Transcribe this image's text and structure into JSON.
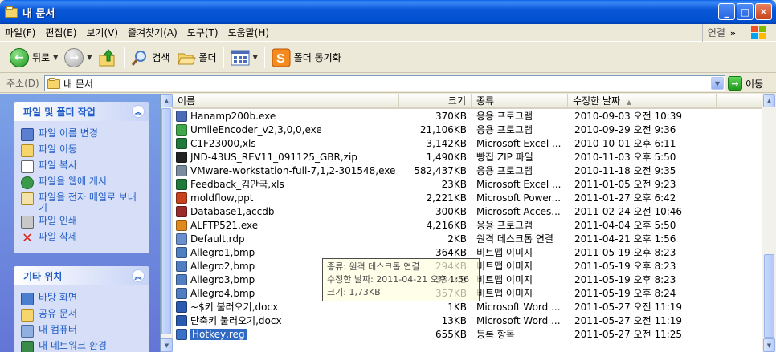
{
  "window": {
    "title": "내 문서"
  },
  "menu": {
    "items": [
      "파일(F)",
      "편집(E)",
      "보기(V)",
      "즐겨찾기(A)",
      "도구(T)",
      "도움말(H)"
    ],
    "links_label": "연결",
    "links_chevron": "»"
  },
  "toolbar": {
    "back_label": "뒤로",
    "search_label": "검색",
    "folders_label": "폴더",
    "sync_label": "폴더 동기화"
  },
  "address": {
    "label": "주소(D)",
    "value": "내 문서",
    "go_label": "이동"
  },
  "tasks_panel": {
    "title": "파일 및 폴더 작업",
    "items": [
      {
        "label": "파일 이름 변경",
        "icon": "rename-icon"
      },
      {
        "label": "파일 이동",
        "icon": "move-icon"
      },
      {
        "label": "파일 복사",
        "icon": "copy-icon"
      },
      {
        "label": "파일을 웹에 게시",
        "icon": "web-publish-icon"
      },
      {
        "label": "파일을 전자 메일로 보내기",
        "icon": "email-icon"
      },
      {
        "label": "파일 인쇄",
        "icon": "print-icon"
      },
      {
        "label": "파일 삭제",
        "icon": "delete-icon"
      }
    ]
  },
  "places_panel": {
    "title": "기타 위치",
    "items": [
      {
        "label": "바탕 화면",
        "icon": "desktop-icon"
      },
      {
        "label": "공유 문서",
        "icon": "shared-folder-icon"
      },
      {
        "label": "내 컴퓨터",
        "icon": "my-computer-icon"
      },
      {
        "label": "내 네트워크 환경",
        "icon": "network-icon"
      }
    ]
  },
  "columns": {
    "name": "이름",
    "size": "크기",
    "type": "종류",
    "modified": "수정한 날짜"
  },
  "files": [
    {
      "name": "Hanamp200b.exe",
      "size": "370KB",
      "type": "응용 프로그램",
      "date": "2010-09-03 오전 10:39",
      "color": "#4a6cb8"
    },
    {
      "name": "UmileEncoder_v2,3,0,0,exe",
      "size": "21,106KB",
      "type": "응용 프로그램",
      "date": "2010-09-29 오전 9:36",
      "color": "#3fa64a"
    },
    {
      "name": "C1F23000,xls",
      "size": "3,142KB",
      "type": "Microsoft Excel ...",
      "date": "2010-10-01 오후 6:11",
      "color": "#1f7a3a"
    },
    {
      "name": "JND-43US_REV11_091125_GBR,zip",
      "size": "1,490KB",
      "type": "빵집 ZIP 파일",
      "date": "2010-11-03 오후 5:50",
      "color": "#222222"
    },
    {
      "name": "VMware-workstation-full-7,1,2-301548,exe",
      "size": "582,437KB",
      "type": "응용 프로그램",
      "date": "2010-11-18 오전 9:35",
      "color": "#7a8ca0"
    },
    {
      "name": "Feedback_김안국,xls",
      "size": "23KB",
      "type": "Microsoft Excel ...",
      "date": "2011-01-05 오전 9:23",
      "color": "#1f7a3a"
    },
    {
      "name": "moldflow,ppt",
      "size": "2,221KB",
      "type": "Microsoft Power...",
      "date": "2011-01-27 오후 6:42",
      "color": "#c8401c"
    },
    {
      "name": "Database1,accdb",
      "size": "300KB",
      "type": "Microsoft Acces...",
      "date": "2011-02-24 오전 10:46",
      "color": "#9a2a2a"
    },
    {
      "name": "ALFTP521,exe",
      "size": "4,216KB",
      "type": "응용 프로그램",
      "date": "2011-04-04 오후 5:50",
      "color": "#e08a1c"
    },
    {
      "name": "Default,rdp",
      "size": "2KB",
      "type": "원격 데스크톱 연결",
      "date": "2011-04-21 오후 1:56",
      "color": "#6a8fd0"
    },
    {
      "name": "Allegro1,bmp",
      "size": "364KB",
      "type": "비트맵 이미지",
      "date": "2011-05-19 오후 8:23",
      "color": "#4f7fc0"
    },
    {
      "name": "Allegro2,bmp",
      "size": "294KB",
      "type": "비트맵 이미지",
      "date": "2011-05-19 오후 8:23",
      "color": "#4f7fc0"
    },
    {
      "name": "Allegro3,bmp",
      "size": "334KB",
      "type": "비트맵 이미지",
      "date": "2011-05-19 오후 8:23",
      "color": "#4f7fc0"
    },
    {
      "name": "Allegro4,bmp",
      "size": "357KB",
      "type": "비트맵 이미지",
      "date": "2011-05-19 오후 8:24",
      "color": "#4f7fc0"
    },
    {
      "name": "~$키 불러오기,docx",
      "size": "1KB",
      "type": "Microsoft Word ...",
      "date": "2011-05-27 오전 11:19",
      "color": "#2a5ab0"
    },
    {
      "name": "단축키 불러오기,docx",
      "size": "13KB",
      "type": "Microsoft Word ...",
      "date": "2011-05-27 오전 11:19",
      "color": "#2a5ab0"
    },
    {
      "name": "Hotkey,reg",
      "size": "655KB",
      "type": "등록 항목",
      "date": "2011-05-27 오전 11:25",
      "color": "#3a70c8"
    }
  ],
  "tooltip": {
    "type_line": "종류: 원격 데스크톱 연결",
    "modified_line": "수정한 날짜: 2011-04-21 오후 1:56",
    "size_line": "크기: 1,73KB"
  }
}
